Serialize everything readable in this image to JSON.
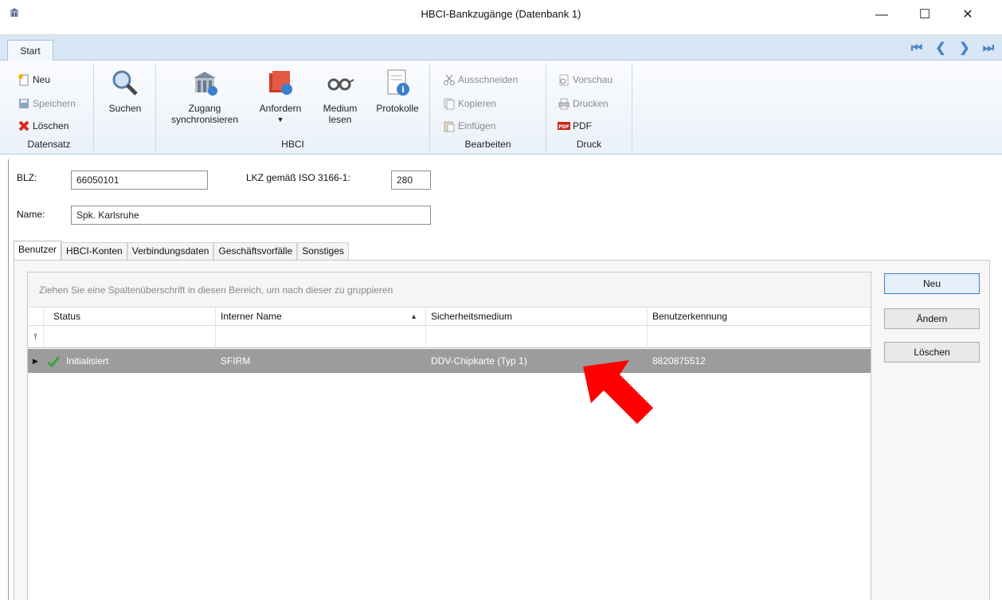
{
  "window": {
    "title": "HBCI-Bankzugänge (Datenbank 1)",
    "minimize": "—",
    "maximize": "☐",
    "close": "✕"
  },
  "ribbon": {
    "tab": "Start",
    "datensatz": {
      "label": "Datensatz",
      "neu": "Neu",
      "speichern": "Speichern",
      "loeschen": "Löschen"
    },
    "suchen": "Suchen",
    "hbci": {
      "label": "HBCI",
      "zugang": "Zugang synchronisieren",
      "anfordern": "Anfordern",
      "medium": "Medium lesen",
      "protokolle": "Protokolle"
    },
    "bearbeiten": {
      "label": "Bearbeiten",
      "ausschneiden": "Ausschneiden",
      "kopieren": "Kopieren",
      "einfuegen": "Einfügen"
    },
    "druck": {
      "label": "Druck",
      "vorschau": "Vorschau",
      "drucken": "Drucken",
      "pdf": "PDF"
    }
  },
  "form": {
    "blz_label": "BLZ:",
    "blz_value": "66050101",
    "lkz_label": "LKZ gemäß ISO 3166-1:",
    "lkz_value": "280",
    "name_label": "Name:",
    "name_value": "Spk. Karlsruhe"
  },
  "tabs": [
    "Benutzer",
    "HBCI-Konten",
    "Verbindungsdaten",
    "Geschäftsvorfälle",
    "Sonstiges"
  ],
  "grid": {
    "group_hint": "Ziehen Sie eine Spaltenüberschrift in diesen Bereich, um nach dieser zu gruppieren",
    "columns": [
      "Status",
      "Interner Name",
      "Sicherheitsmedium",
      "Benutzerkennung"
    ],
    "rows": [
      {
        "status": "Initialisiert",
        "intern": "SFIRM",
        "medium": "DDV-Chipkarte (Typ 1)",
        "kennung": "8820875512"
      }
    ]
  },
  "buttons": {
    "neu": "Neu",
    "aendern": "Ändern",
    "loeschen": "Löschen"
  },
  "colors": {
    "accent": "#3b7fcf",
    "selected_row": "#9c9c9c",
    "arrow": "#ff0000"
  },
  "icons": [
    "app-icon",
    "new-icon",
    "save-icon",
    "delete-icon",
    "search-icon",
    "bank-sync-icon",
    "request-icon",
    "glasses-icon",
    "protocol-icon",
    "cut-icon",
    "copy-icon",
    "paste-icon",
    "preview-icon",
    "print-icon",
    "pdf-icon"
  ]
}
